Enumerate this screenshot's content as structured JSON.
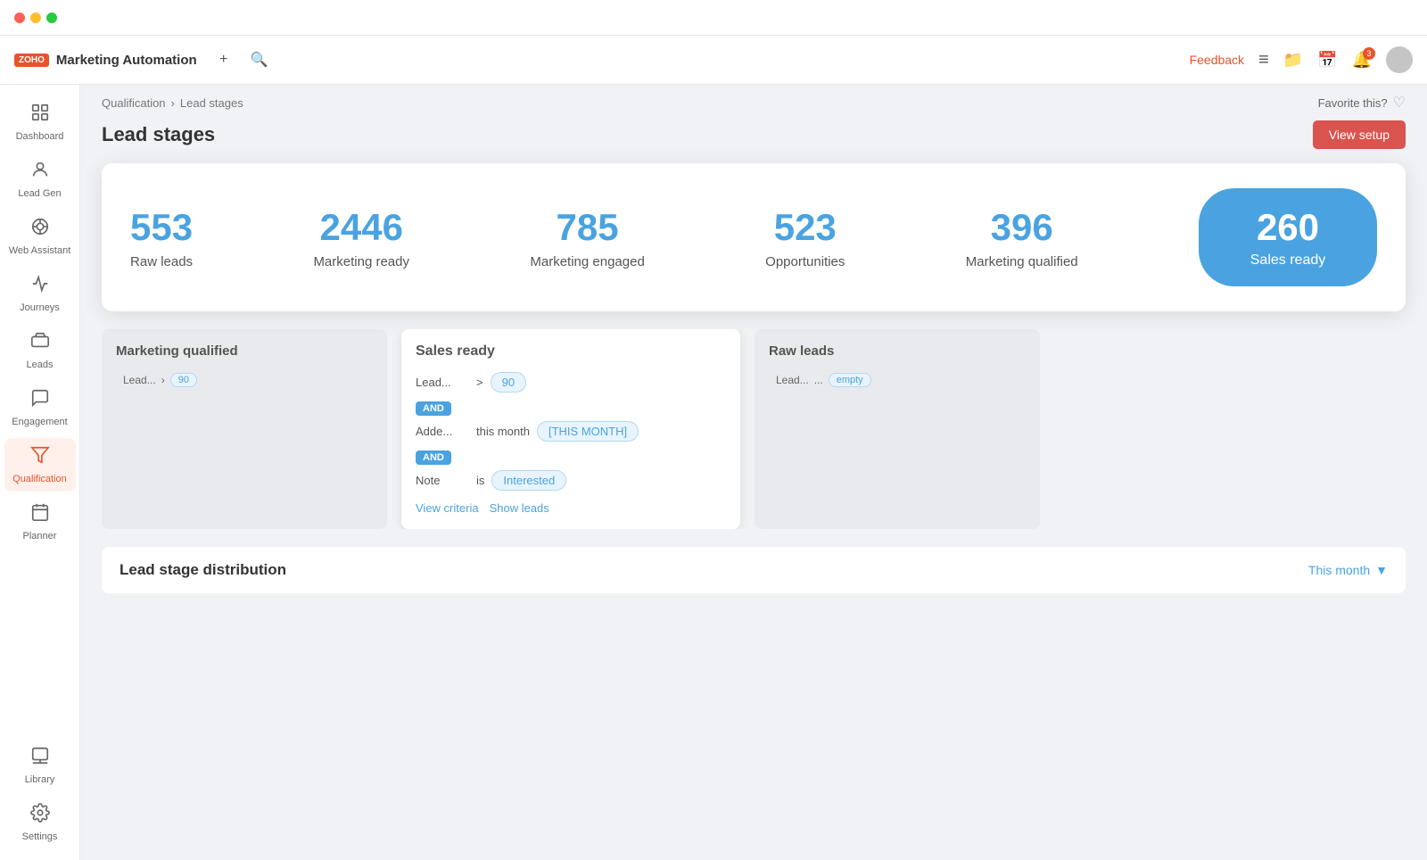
{
  "window": {
    "title": "Marketing Automation"
  },
  "titlebar": {
    "lights": [
      "red",
      "yellow",
      "green"
    ]
  },
  "appbar": {
    "logo_text": "ZOHO",
    "title": "Marketing Automation",
    "add_label": "+",
    "feedback_label": "Feedback",
    "notification_count": "3"
  },
  "breadcrumb": {
    "parent": "Qualification",
    "separator": ">",
    "current": "Lead stages",
    "favorite_label": "Favorite this?"
  },
  "page": {
    "title": "Lead stages",
    "view_setup_label": "View setup"
  },
  "stats": [
    {
      "number": "553",
      "label": "Raw leads"
    },
    {
      "number": "2446",
      "label": "Marketing ready"
    },
    {
      "number": "785",
      "label": "Marketing engaged"
    },
    {
      "number": "523",
      "label": "Opportunities"
    },
    {
      "number": "396",
      "label": "Marketing qualified"
    },
    {
      "number": "260",
      "label": "Sales ready"
    }
  ],
  "sidebar": {
    "items": [
      {
        "id": "dashboard",
        "label": "Dashboard",
        "icon": "⊞"
      },
      {
        "id": "lead-gen",
        "label": "Lead Gen",
        "icon": "👤"
      },
      {
        "id": "web-assistant",
        "label": "Web Assistant",
        "icon": "🤖"
      },
      {
        "id": "journeys",
        "label": "Journeys",
        "icon": "🗺"
      },
      {
        "id": "leads",
        "label": "Leads",
        "icon": "🏷"
      },
      {
        "id": "engagement",
        "label": "Engagement",
        "icon": "📣"
      },
      {
        "id": "qualification",
        "label": "Qualification",
        "icon": "⚡",
        "active": true
      },
      {
        "id": "planner",
        "label": "Planner",
        "icon": "📅"
      },
      {
        "id": "library",
        "label": "Library",
        "icon": "🖼"
      },
      {
        "id": "settings",
        "label": "Settings",
        "icon": "⚙"
      }
    ]
  },
  "cards": {
    "marketing_qualified": {
      "title": "Marketing qualified",
      "criteria_label": "Lead...",
      "criteria_op": ">",
      "criteria_val": "90"
    },
    "sales_ready": {
      "title": "Sales ready",
      "criteria": [
        {
          "field": "Lead...",
          "op": ">",
          "val": "90"
        },
        {
          "connector": "AND"
        },
        {
          "field": "Adde...",
          "op": "this month",
          "val": "[THIS MONTH]"
        },
        {
          "connector": "AND"
        },
        {
          "field": "Note",
          "op": "is",
          "val": "Interested"
        }
      ],
      "view_criteria_label": "View criteria",
      "show_leads_label": "Show leads"
    },
    "raw_leads": {
      "title": "Raw leads",
      "criteria_label": "Lead...",
      "criteria_op": "...",
      "criteria_val": "empty"
    }
  },
  "distribution": {
    "title": "Lead stage distribution",
    "period_label": "This month",
    "period_icon": "▼"
  }
}
